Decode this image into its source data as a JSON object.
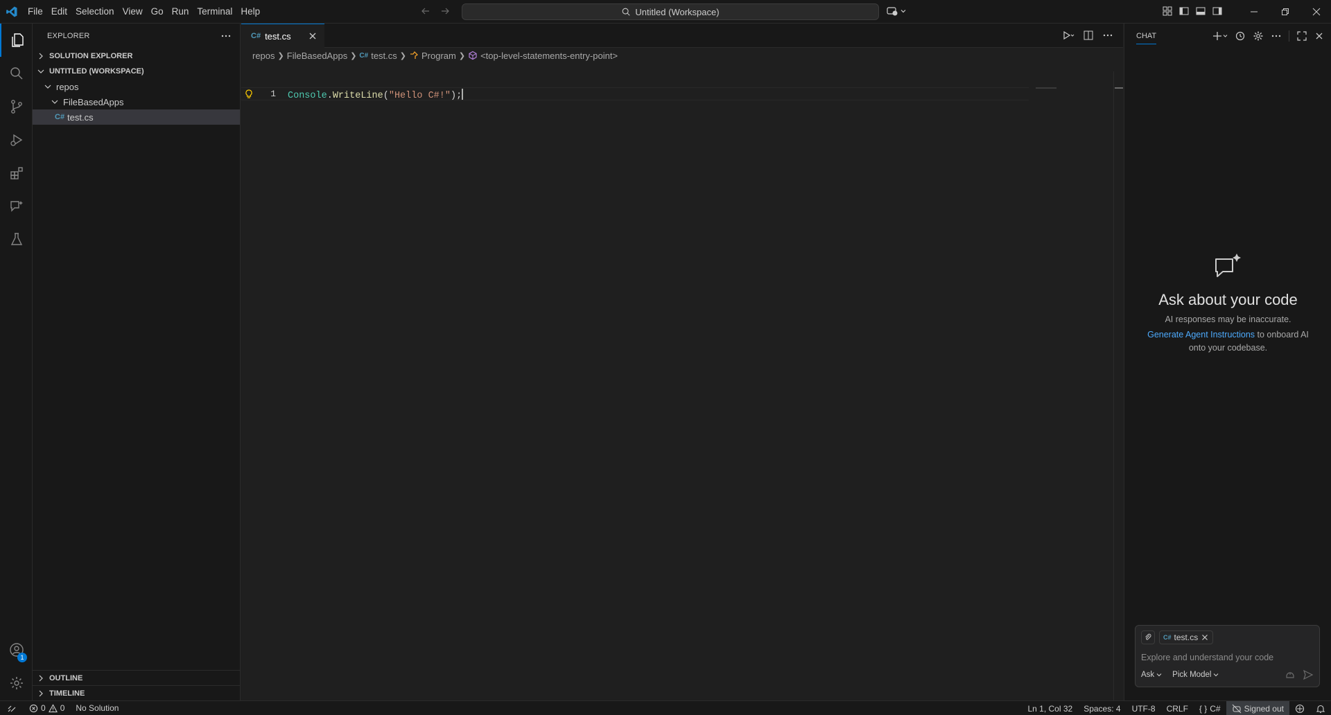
{
  "titlebar": {
    "menu": [
      "File",
      "Edit",
      "Selection",
      "View",
      "Go",
      "Run",
      "Terminal",
      "Help"
    ],
    "search_text": "Untitled (Workspace)"
  },
  "sidebar": {
    "title": "EXPLORER",
    "solution_explorer": "SOLUTION EXPLORER",
    "workspace": "UNTITLED (WORKSPACE)",
    "tree": {
      "folder1": "repos",
      "folder2": "FileBasedApps",
      "file": "test.cs"
    },
    "outline": "OUTLINE",
    "timeline": "TIMELINE"
  },
  "editor": {
    "tab_label": "test.cs",
    "breadcrumbs": [
      "repos",
      "FileBasedApps",
      "test.cs",
      "Program",
      "<top-level-statements-entry-point>"
    ],
    "line_number": "1",
    "code": {
      "class": "Console",
      "dot": ".",
      "method": "WriteLine",
      "open": "(",
      "string": "\"Hello C#!\"",
      "close": ");"
    }
  },
  "chat": {
    "title": "CHAT",
    "heading": "Ask about your code",
    "disclaimer": "AI responses may be inaccurate.",
    "link": "Generate Agent Instructions",
    "link_suffix": " to onboard AI onto your codebase.",
    "attachment": "test.cs",
    "placeholder": "Explore and understand your code",
    "mode": "Ask",
    "model": "Pick Model"
  },
  "statusbar": {
    "errors": "0",
    "warnings": "0",
    "solution": "No Solution",
    "position": "Ln 1, Col 32",
    "spaces": "Spaces: 4",
    "encoding": "UTF-8",
    "eol": "CRLF",
    "language": "C#",
    "account": "Signed out",
    "notification_badge": "1"
  },
  "colors": {
    "accent": "#0078d4",
    "link": "#4daafc",
    "csharp_icon": "#519aba"
  }
}
